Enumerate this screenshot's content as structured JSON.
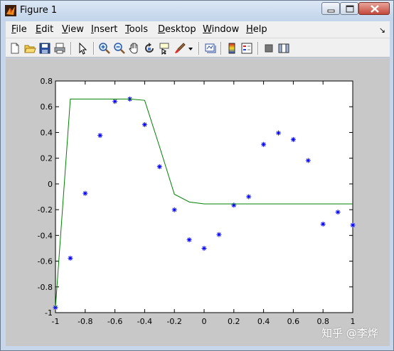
{
  "window": {
    "title": "Figure 1"
  },
  "menu": [
    "File",
    "Edit",
    "View",
    "Insert",
    "Tools",
    "Desktop",
    "Window",
    "Help"
  ],
  "menu_dock_glyph": "↘",
  "toolbar_icons": [
    "new-figure-icon",
    "open-file-icon",
    "save-icon",
    "print-icon",
    "pointer-icon",
    "zoom-in-icon",
    "zoom-out-icon",
    "pan-hand-icon",
    "rotate-3d-icon",
    "data-cursor-icon",
    "brush-icon",
    "dropdown-arrow-icon",
    "link-plot-icon",
    "colorbar-icon",
    "legend-icon",
    "hide-plot-tools-icon",
    "show-plot-tools-icon"
  ],
  "colors": {
    "marker": "#0000ff",
    "line": "#008000",
    "axes_bg": "#ffffff",
    "figure_bg": "#c8c8c8"
  },
  "watermark": "知乎 @李烨",
  "chart_data": {
    "type": "line",
    "xlim": [
      -1,
      1
    ],
    "ylim": [
      -1,
      0.8
    ],
    "xticks": [
      "-1",
      "-0.8",
      "-0.6",
      "-0.4",
      "-0.2",
      "0",
      "0.2",
      "0.4",
      "0.6",
      "0.8",
      "1"
    ],
    "yticks": [
      "-1",
      "-0.8",
      "-0.6",
      "-0.4",
      "-0.2",
      "0",
      "0.2",
      "0.4",
      "0.6",
      "0.8"
    ],
    "grid": false,
    "series": [
      {
        "style": "markers-star",
        "color": "#0000ff",
        "x": [
          -1,
          -0.9,
          -0.8,
          -0.7,
          -0.6,
          -0.5,
          -0.4,
          -0.3,
          -0.2,
          -0.1,
          0,
          0.1,
          0.2,
          0.3,
          0.4,
          0.5,
          0.6,
          0.7,
          0.8,
          0.9,
          1
        ],
        "y": [
          -0.96,
          -0.577,
          -0.073,
          0.377,
          0.641,
          0.66,
          0.461,
          0.134,
          -0.201,
          -0.434,
          -0.5,
          -0.393,
          -0.165,
          -0.099,
          0.307,
          0.396,
          0.345,
          0.182,
          -0.312,
          -0.219,
          -0.32
        ]
      },
      {
        "style": "line",
        "color": "#008000",
        "x": [
          -1,
          -0.9,
          -0.8,
          -0.7,
          -0.6,
          -0.5,
          -0.4,
          -0.3,
          -0.2,
          -0.1,
          0,
          0.1,
          0.2,
          0.3,
          0.4,
          0.5,
          0.6,
          0.7,
          0.8,
          0.9,
          1
        ],
        "y": [
          -0.96,
          0.66,
          0.66,
          0.66,
          0.66,
          0.66,
          0.65,
          0.29,
          -0.08,
          -0.14,
          -0.155,
          -0.155,
          -0.155,
          -0.155,
          -0.155,
          -0.155,
          -0.155,
          -0.155,
          -0.155,
          -0.155,
          -0.155
        ]
      }
    ]
  }
}
